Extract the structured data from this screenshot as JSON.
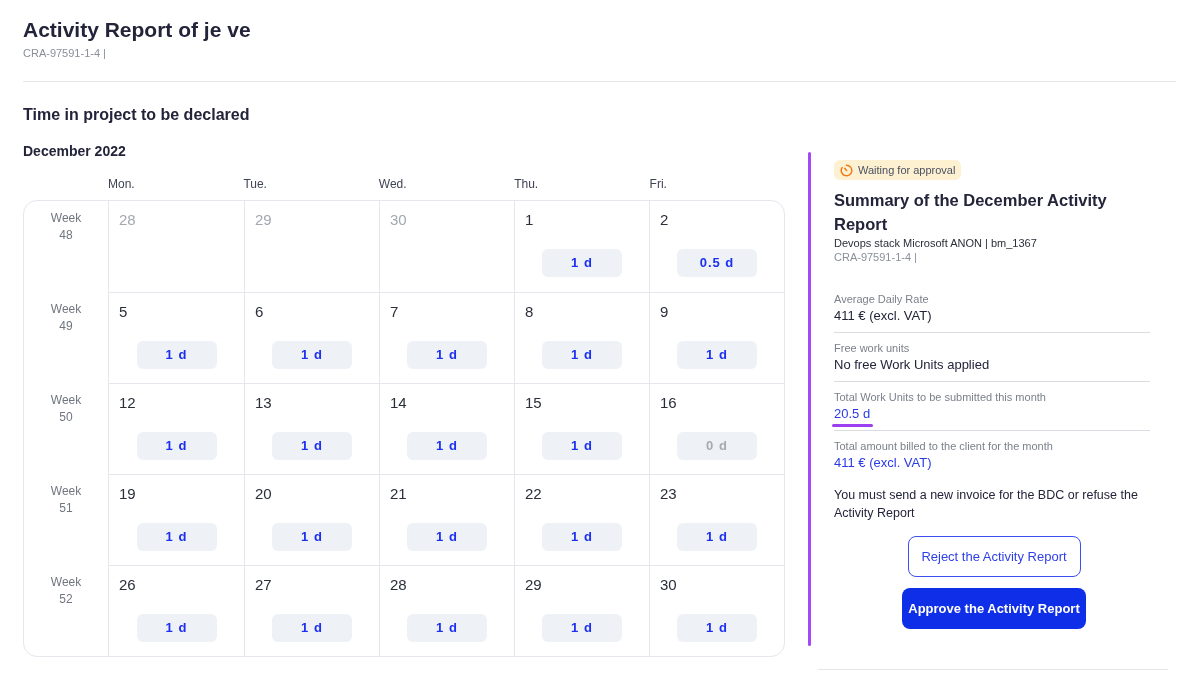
{
  "header": {
    "title": "Activity Report of je ve",
    "reference": "CRA-97591-1-4 |"
  },
  "calendar": {
    "heading": "Time in project to be declared",
    "month": "December 2022",
    "weekdays": [
      "Mon.",
      "Tue.",
      "Wed.",
      "Thu.",
      "Fri."
    ],
    "weeks": [
      {
        "label": "Week 48",
        "days": [
          {
            "date": "28",
            "outside_month": true
          },
          {
            "date": "29",
            "outside_month": true
          },
          {
            "date": "30",
            "outside_month": true
          },
          {
            "date": "1",
            "outside_month": false,
            "badge": {
              "text": "1 d",
              "dimmed": false
            }
          },
          {
            "date": "2",
            "outside_month": false,
            "badge": {
              "text": "0.5 d",
              "dimmed": false
            }
          }
        ]
      },
      {
        "label": "Week 49",
        "days": [
          {
            "date": "5",
            "outside_month": false,
            "badge": {
              "text": "1 d",
              "dimmed": false
            }
          },
          {
            "date": "6",
            "outside_month": false,
            "badge": {
              "text": "1 d",
              "dimmed": false
            }
          },
          {
            "date": "7",
            "outside_month": false,
            "badge": {
              "text": "1 d",
              "dimmed": false
            }
          },
          {
            "date": "8",
            "outside_month": false,
            "badge": {
              "text": "1 d",
              "dimmed": false
            }
          },
          {
            "date": "9",
            "outside_month": false,
            "badge": {
              "text": "1 d",
              "dimmed": false
            }
          }
        ]
      },
      {
        "label": "Week 50",
        "days": [
          {
            "date": "12",
            "outside_month": false,
            "badge": {
              "text": "1 d",
              "dimmed": false
            }
          },
          {
            "date": "13",
            "outside_month": false,
            "badge": {
              "text": "1 d",
              "dimmed": false
            }
          },
          {
            "date": "14",
            "outside_month": false,
            "badge": {
              "text": "1 d",
              "dimmed": false
            }
          },
          {
            "date": "15",
            "outside_month": false,
            "badge": {
              "text": "1 d",
              "dimmed": false
            }
          },
          {
            "date": "16",
            "outside_month": false,
            "badge": {
              "text": "0 d",
              "dimmed": true
            }
          }
        ]
      },
      {
        "label": "Week 51",
        "days": [
          {
            "date": "19",
            "outside_month": false,
            "badge": {
              "text": "1 d",
              "dimmed": false
            }
          },
          {
            "date": "20",
            "outside_month": false,
            "badge": {
              "text": "1 d",
              "dimmed": false
            }
          },
          {
            "date": "21",
            "outside_month": false,
            "badge": {
              "text": "1 d",
              "dimmed": false
            }
          },
          {
            "date": "22",
            "outside_month": false,
            "badge": {
              "text": "1 d",
              "dimmed": false
            }
          },
          {
            "date": "23",
            "outside_month": false,
            "badge": {
              "text": "1 d",
              "dimmed": false
            }
          }
        ]
      },
      {
        "label": "Week 52",
        "days": [
          {
            "date": "26",
            "outside_month": false,
            "badge": {
              "text": "1 d",
              "dimmed": false
            }
          },
          {
            "date": "27",
            "outside_month": false,
            "badge": {
              "text": "1 d",
              "dimmed": false
            }
          },
          {
            "date": "28",
            "outside_month": false,
            "badge": {
              "text": "1 d",
              "dimmed": false
            }
          },
          {
            "date": "29",
            "outside_month": false,
            "badge": {
              "text": "1 d",
              "dimmed": false
            }
          },
          {
            "date": "30",
            "outside_month": false,
            "badge": {
              "text": "1 d",
              "dimmed": false
            }
          }
        ]
      }
    ]
  },
  "summary": {
    "status": "Waiting for approval",
    "title": "Summary of the December Activity Report",
    "project": "Devops stack Microsoft ANON | bm_1367",
    "reference": "CRA-97591-1-4 |",
    "fields": [
      {
        "label": "Average Daily Rate",
        "value": "411 € (excl. VAT)",
        "accent": false,
        "highlighted": false
      },
      {
        "label": "Free work units",
        "value": "No free Work Units applied",
        "accent": false,
        "highlighted": false
      },
      {
        "label": "Total Work Units to be submitted this month",
        "value": "20.5 d",
        "accent": true,
        "highlighted": true
      },
      {
        "label": "Total amount billed to the client for the month",
        "value": "411 € (excl. VAT)",
        "accent": true,
        "highlighted": false
      }
    ],
    "notice": "You must send a new invoice for the BDC or refuse the Activity Report",
    "actions": [
      {
        "label": "Reject the Activity Report",
        "kind": "outline"
      },
      {
        "label": "Approve the Activity Report",
        "kind": "primary"
      }
    ]
  }
}
